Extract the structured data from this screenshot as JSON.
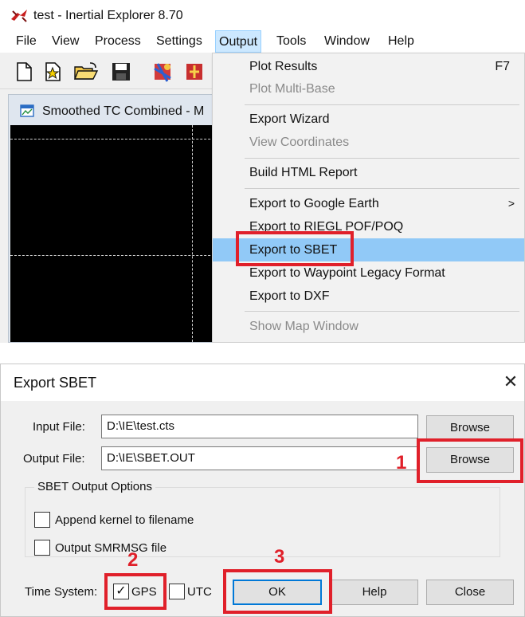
{
  "app": {
    "title": "test - Inertial Explorer 8.70",
    "menu": [
      "File",
      "View",
      "Process",
      "Settings",
      "Output",
      "Tools",
      "Window",
      "Help"
    ],
    "active_menu": "Output",
    "child_window_title": "Smoothed TC Combined - M"
  },
  "toolbar_icons": [
    "new-file-icon",
    "new-star-file-icon",
    "open-folder-icon",
    "save-icon",
    "process-icon",
    "process-combined-icon"
  ],
  "output_menu": {
    "items": [
      {
        "label": "Plot Results",
        "shortcut": "F7",
        "disabled": false
      },
      {
        "label": "Plot Multi-Base",
        "disabled": true
      },
      {
        "label": "Export Wizard",
        "disabled": false
      },
      {
        "label": "View Coordinates",
        "disabled": true
      },
      {
        "label": "Build HTML Report",
        "disabled": false
      },
      {
        "label": "Export to Google Earth",
        "submenu_arrow": ">",
        "disabled": false
      },
      {
        "label": "Export to RIEGL POF/POQ",
        "disabled": false
      },
      {
        "label": "Export to SBET",
        "highlighted": true,
        "disabled": false
      },
      {
        "label": "Export to Waypoint Legacy Format",
        "disabled": false
      },
      {
        "label": "Export to DXF",
        "disabled": false
      },
      {
        "label": "Show Map Window",
        "disabled": true
      }
    ]
  },
  "dialog": {
    "title": "Export SBET",
    "close_glyph": "✕",
    "input_file_label": "Input File:",
    "input_file_value": "D:\\IE\\test.cts",
    "output_file_label": "Output File:",
    "output_file_value": "D:\\IE\\SBET.OUT",
    "browse_label": "Browse",
    "options_group_label": "SBET Output Options",
    "append_kernel_label": "Append kernel to filename",
    "append_kernel_checked": false,
    "output_smrmsg_label": "Output SMRMSG file",
    "output_smrmsg_checked": false,
    "time_system_label": "Time System:",
    "gps_label": "GPS",
    "gps_checked": true,
    "utc_label": "UTC",
    "utc_checked": false,
    "ok_label": "OK",
    "help_label": "Help",
    "close_label": "Close"
  },
  "annotations": {
    "step1": "1",
    "step2": "2",
    "step3": "3",
    "check_glyph": "✓",
    "color": "#e0202a"
  },
  "colors": {
    "menu_highlight": "#91c9f7",
    "active_menu_bg": "#cce8ff",
    "annotation_red": "#e0202a",
    "default_button_border": "#0078d7"
  }
}
